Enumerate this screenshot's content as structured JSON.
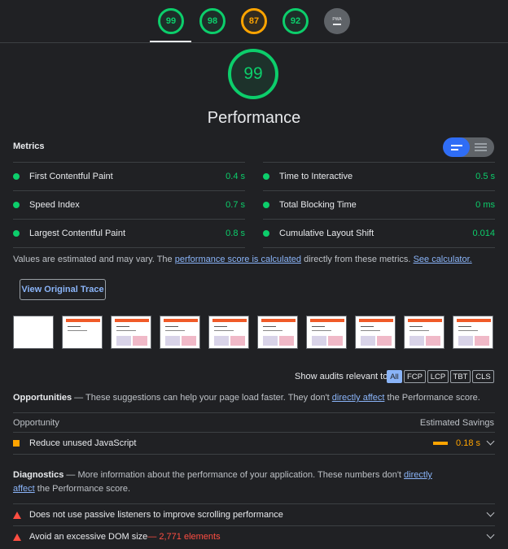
{
  "category_scores": [
    {
      "score": "99",
      "status": "pass"
    },
    {
      "score": "98",
      "status": "pass"
    },
    {
      "score": "87",
      "status": "average"
    },
    {
      "score": "92",
      "status": "pass"
    },
    {
      "score": "PWA",
      "status": "na"
    }
  ],
  "performance": {
    "score": "99",
    "title": "Performance"
  },
  "metrics": {
    "heading": "Metrics",
    "items": [
      {
        "label": "First Contentful Paint",
        "value": "0.4 s"
      },
      {
        "label": "Time to Interactive",
        "value": "0.5 s"
      },
      {
        "label": "Speed Index",
        "value": "0.7 s"
      },
      {
        "label": "Total Blocking Time",
        "value": "0 ms"
      },
      {
        "label": "Largest Contentful Paint",
        "value": "0.8 s"
      },
      {
        "label": "Cumulative Layout Shift",
        "value": "0.014"
      }
    ],
    "note_prefix": "Values are estimated and may vary. The ",
    "note_link1": "performance score is calculated",
    "note_mid": " directly from these metrics. ",
    "note_link2": "See calculator."
  },
  "view_trace_label": "View Original Trace",
  "filter": {
    "label": "Show audits relevant to:",
    "chips": [
      "All",
      "FCP",
      "LCP",
      "TBT",
      "CLS"
    ],
    "active": "All"
  },
  "opportunities": {
    "title": "Opportunities",
    "desc_prefix": " — These suggestions can help your page load faster. They don't ",
    "desc_link": "directly affect",
    "desc_suffix": " the Performance score.",
    "col_left": "Opportunity",
    "col_right": "Estimated Savings",
    "items": [
      {
        "label": "Reduce unused JavaScript",
        "savings": "0.18 s"
      }
    ]
  },
  "diagnostics": {
    "title": "Diagnostics",
    "desc_prefix": " — More information about the performance of your application. These numbers don't ",
    "desc_link": "directly affect",
    "desc_suffix": " the Performance score.",
    "items": [
      {
        "label": "Does not use passive listeners to improve scrolling performance",
        "detail": ""
      },
      {
        "label": "Avoid an excessive DOM size",
        "detail": " — 2,771 elements"
      }
    ]
  },
  "colors": {
    "pass": "#0cce6b",
    "average": "#ffa400",
    "fail": "#ff4e42",
    "link": "#8ab4f8",
    "background": "#202124"
  }
}
